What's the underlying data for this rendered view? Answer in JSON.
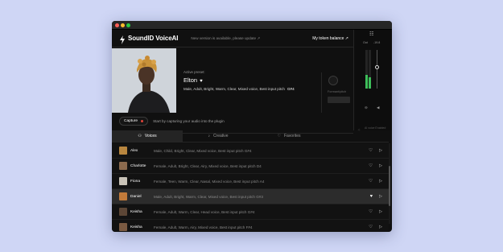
{
  "app": {
    "name": "SoundID VoiceAI",
    "update_notice": "New version is available, please update ↗",
    "token_link": "My token balance ↗"
  },
  "preset": {
    "label": "Active preset:",
    "name": "Elton",
    "tags": "Male, Adult, Bright, Warm, Clear, Mixed voice, Best input pitch",
    "pitch": "G#4"
  },
  "formant": {
    "label": "Formant/pitch",
    "value": ""
  },
  "capture": {
    "button": "Capture",
    "hint": "Start by capturing your audio into the plugin"
  },
  "io": {
    "out_label": "Out",
    "level_label": "-19.8",
    "out_level": 0.35,
    "in_level": 0.3,
    "gain": 0.55
  },
  "ai_label": "AI voice Enabled",
  "tabs": [
    {
      "label": "Voices",
      "icon": "person-icon",
      "active": true
    },
    {
      "label": "Creative",
      "icon": "music-note-icon",
      "active": false
    },
    {
      "label": "Favorites",
      "icon": "heart-icon",
      "active": false
    }
  ],
  "voices": [
    {
      "name": "Alex",
      "desc": "Male, Child, Bright, Clear, Mixed voice, Best input pitch G#4",
      "avatar": "#b8863f",
      "selected": false
    },
    {
      "name": "Charlotte",
      "desc": "Female, Adult, Bright, Clear, Airy, Mixed voice, Best input pitch  D4",
      "avatar": "#8b6a4e",
      "selected": false
    },
    {
      "name": "Fiona",
      "desc": "Female, Teen, Warm, Clear, Nasal, Mixed voice, Best input pitch  A4",
      "avatar": "#c9c3b8",
      "selected": false
    },
    {
      "name": "Daniel",
      "desc": "Male, Adult, Bright, Warm, Clear, Mixed voice, Best input pitch  G#3",
      "avatar": "#c27a3a",
      "selected": true
    },
    {
      "name": "Keisha",
      "desc": "Female, Adult, Warm, Clear, Head voice, Best input pitch  G#4",
      "avatar": "#5c4636",
      "selected": false
    },
    {
      "name": "Keisha",
      "desc": "Female, Adult, Warm, Airy, Mixed voice, Best input pitch  F#4",
      "avatar": "#7a5a42",
      "selected": false
    }
  ]
}
